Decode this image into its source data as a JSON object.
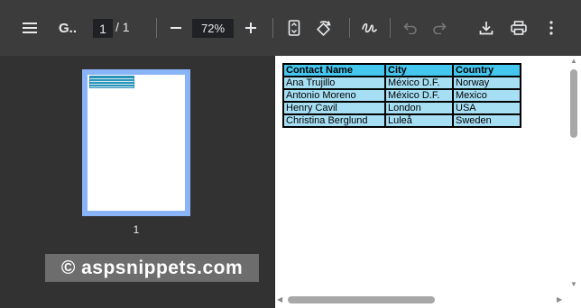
{
  "toolbar": {
    "title": "G..",
    "page_current": "1",
    "page_sep": "/",
    "page_total": "1",
    "zoom": "72%"
  },
  "icons": [
    "menu-icon",
    "zoom-out-icon",
    "zoom-in-icon",
    "fit-page-icon",
    "rotate-icon",
    "annotate-icon",
    "undo-icon",
    "redo-icon",
    "download-icon",
    "print-icon",
    "more-icon"
  ],
  "sidebar": {
    "thumb_label": "1",
    "watermark": "© aspsnippets.com"
  },
  "table": {
    "headers": [
      "Contact Name",
      "City",
      "Country"
    ],
    "rows": [
      [
        "Ana Trujillo",
        "México D.F.",
        "Norway"
      ],
      [
        "Antonio Moreno",
        "México D.F.",
        "Mexico"
      ],
      [
        "Henry Cavil",
        "London",
        "USA"
      ],
      [
        "Christina Berglund",
        "Luleå",
        "Sweden"
      ]
    ]
  },
  "colors": {
    "header_bg": "#44c7ee",
    "row_bg": "#a6dff3",
    "toolbar_bg": "#3c3c3c",
    "accent": "#8ab4f8"
  }
}
